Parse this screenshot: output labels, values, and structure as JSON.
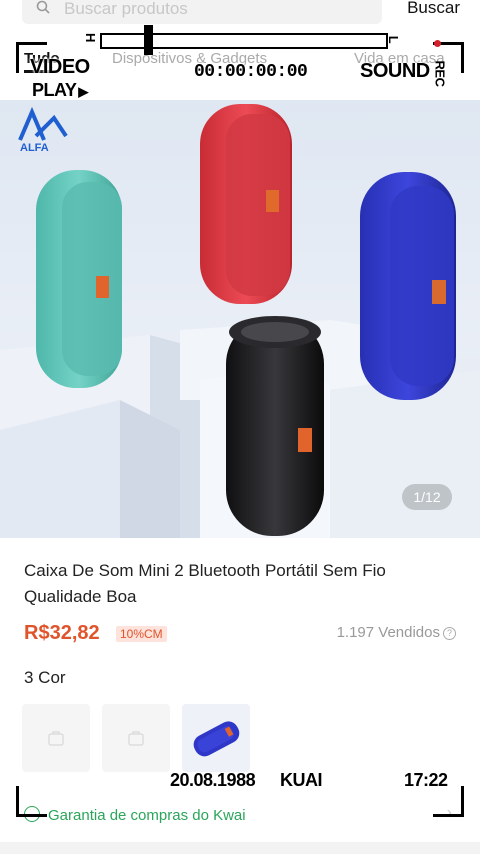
{
  "search": {
    "placeholder": "Buscar produtos",
    "button_label": "Buscar"
  },
  "tabs": [
    {
      "label": "Tudo",
      "active": true
    },
    {
      "label": "Dispositivos & Gadgets",
      "active": false
    },
    {
      "label": "Vida em casa",
      "active": false
    }
  ],
  "gallery": {
    "counter": "1/12",
    "logo_text": "ALFA"
  },
  "product": {
    "title": "Caixa De Som Mini 2 Bluetooth Portátil Sem Fio Qualidade Boa",
    "price": "R$32,82",
    "discount": "10%CM",
    "sold": "1.197 Vendidos",
    "color_label": "3 Cor",
    "guarantee": "Garantia de compras do Kwai"
  },
  "overlay": {
    "video_label": "VIDEO",
    "play_label": "PLAY",
    "timecode": "00:00:00:00",
    "sound_label": "SOUND",
    "rec_label": "REC",
    "slider_h": "H",
    "slider_l": "L",
    "date": "20.08.1988",
    "channel": "KUAI",
    "time": "17:22"
  },
  "colors": {
    "price": "#e0542b",
    "guarantee": "#2aa55a",
    "speaker_teal": "#63c9bd",
    "speaker_red": "#e23f47",
    "speaker_blue": "#2e36c9",
    "speaker_black": "#1d1d1f"
  }
}
